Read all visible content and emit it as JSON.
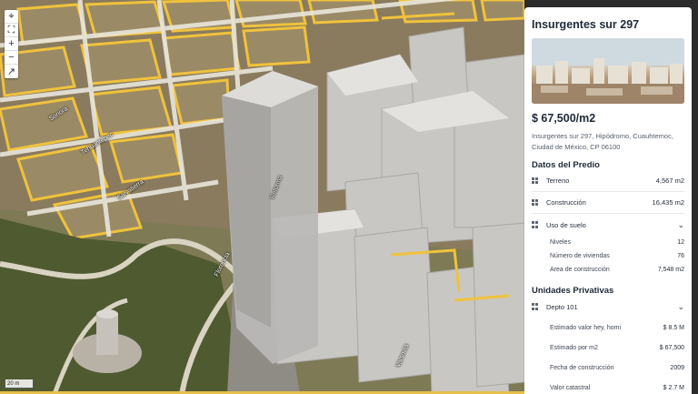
{
  "map": {
    "street_labels": [
      "Sonora",
      "Tehuantepec",
      "Salvatierra",
      "Florencia",
      "Varsovia"
    ],
    "building_label": "Reforma",
    "scale_label": "20 m",
    "controls": [
      {
        "name": "locate-icon",
        "glyph": "⌖"
      },
      {
        "name": "fullscreen-icon",
        "glyph": "⛶"
      },
      {
        "name": "zoom-in-icon",
        "glyph": "+"
      },
      {
        "name": "zoom-out-icon",
        "glyph": "−"
      },
      {
        "name": "compass-icon",
        "glyph": "↗"
      }
    ]
  },
  "panel": {
    "title": "Insurgentes sur 297",
    "price": "$ 67,500/m2",
    "address": "Insurgentes sur 297, Hipódromo, Cuauhtemoc, Ciudad de México, CP 06100",
    "predio": {
      "title": "Datos del Predio",
      "terreno_label": "Terreno",
      "terreno_value": "4,567 m2",
      "construccion_label": "Construcción",
      "construccion_value": "16,435 m2",
      "uso_label": "Uso de suelo",
      "sub": [
        {
          "label": "Niveles",
          "value": "12"
        },
        {
          "label": "Número de viviendas",
          "value": "76"
        },
        {
          "label": "Area de construcción",
          "value": "7,548 m2"
        }
      ]
    },
    "privativas": {
      "title": "Unidades Privativas",
      "depto_label": "Depto 101",
      "rows": [
        {
          "label": "Estimado valor hey, homi",
          "value": "$ 8.5 M"
        },
        {
          "label": "Estimado por m2",
          "value": "$ 67,500"
        },
        {
          "label": "Fecha de construcción",
          "value": "2009"
        },
        {
          "label": "Valor catastral",
          "value": "$ 2.7 M"
        }
      ]
    }
  }
}
